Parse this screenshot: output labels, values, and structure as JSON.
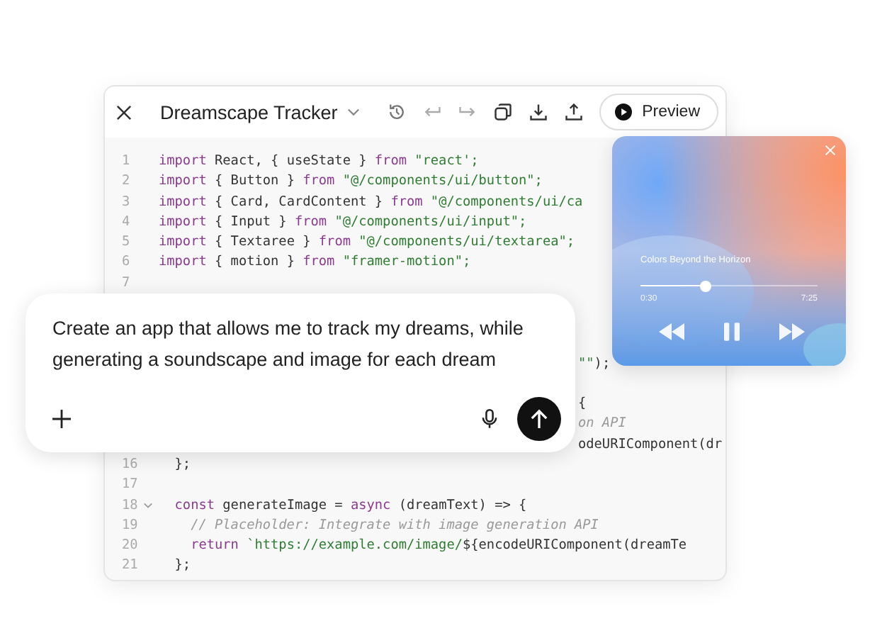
{
  "editor": {
    "title": "Dreamscape Tracker",
    "preview_button": "Preview",
    "lines": [
      {
        "kind": "line",
        "number": "1",
        "segments": [
          {
            "kind": "keyword",
            "text": "import"
          },
          {
            "kind": "plain",
            "text": " React, { useState } "
          },
          {
            "kind": "keyword",
            "text": "from"
          },
          {
            "kind": "string",
            "text": " \"react';"
          }
        ]
      },
      {
        "kind": "line",
        "number": "2",
        "segments": [
          {
            "kind": "keyword",
            "text": "import"
          },
          {
            "kind": "plain",
            "text": " { Button } "
          },
          {
            "kind": "keyword",
            "text": "from"
          },
          {
            "kind": "string",
            "text": " \"@/components/ui/button\";"
          }
        ]
      },
      {
        "kind": "line",
        "number": "3",
        "segments": [
          {
            "kind": "keyword",
            "text": "import"
          },
          {
            "kind": "plain",
            "text": " { Card, CardContent } "
          },
          {
            "kind": "keyword",
            "text": "from"
          },
          {
            "kind": "string",
            "text": " \"@/components/ui/ca"
          }
        ]
      },
      {
        "kind": "line",
        "number": "4",
        "segments": [
          {
            "kind": "keyword",
            "text": "import"
          },
          {
            "kind": "plain",
            "text": " { Input } "
          },
          {
            "kind": "keyword",
            "text": "from"
          },
          {
            "kind": "string",
            "text": " \"@/components/ui/input\";"
          }
        ]
      },
      {
        "kind": "line",
        "number": "5",
        "segments": [
          {
            "kind": "keyword",
            "text": "import"
          },
          {
            "kind": "plain",
            "text": " { Textaree } "
          },
          {
            "kind": "keyword",
            "text": "from"
          },
          {
            "kind": "string",
            "text": " \"@/components/ui/textarea\";"
          }
        ]
      },
      {
        "kind": "line",
        "number": "6",
        "segments": [
          {
            "kind": "keyword",
            "text": "import"
          },
          {
            "kind": "plain",
            "text": " { motion } "
          },
          {
            "kind": "keyword",
            "text": "from"
          },
          {
            "kind": "string",
            "text": " \"framer-motion\";"
          }
        ]
      },
      {
        "kind": "line",
        "number": "7"
      },
      {
        "kind": "covered"
      },
      {
        "kind": "covered"
      },
      {
        "kind": "covered"
      },
      {
        "kind": "covered",
        "segments": [
          {
            "kind": "string",
            "text": "\"\""
          },
          {
            "kind": "plain",
            "text": ");"
          }
        ]
      },
      {
        "kind": "covered"
      },
      {
        "kind": "covered",
        "segments": [
          {
            "kind": "plain",
            "text": "{"
          }
        ]
      },
      {
        "kind": "covered",
        "segments": [
          {
            "kind": "comment",
            "text": "on API"
          }
        ]
      },
      {
        "kind": "covered",
        "segments": [
          {
            "kind": "plain",
            "text": "odeURIComponent(dr"
          }
        ]
      },
      {
        "kind": "line",
        "number": "16",
        "segments": [
          {
            "kind": "plain",
            "text": "  };"
          }
        ]
      },
      {
        "kind": "line",
        "number": "17"
      },
      {
        "kind": "line",
        "number": "18",
        "expanded": true,
        "segments": [
          {
            "kind": "keyword",
            "text": "  const"
          },
          {
            "kind": "plain",
            "text": " generateImage = "
          },
          {
            "kind": "keyword",
            "text": "async"
          },
          {
            "kind": "plain",
            "text": " (dreamText) => {"
          }
        ]
      },
      {
        "kind": "line",
        "number": "19",
        "segments": [
          {
            "kind": "comment",
            "text": "    // Placeholder: Integrate with image generation API"
          }
        ]
      },
      {
        "kind": "line",
        "number": "20",
        "segments": [
          {
            "kind": "keyword",
            "text": "    return"
          },
          {
            "kind": "string",
            "text": " `https://example.com/image/"
          },
          {
            "kind": "plain",
            "text": "${encodeURIComponent(dreamTe"
          }
        ]
      },
      {
        "kind": "line",
        "number": "21",
        "segments": [
          {
            "kind": "plain",
            "text": "  };"
          }
        ]
      }
    ]
  },
  "player": {
    "title": "Colors Beyond the Horizon",
    "level": 0.37,
    "elapsed": "0:30",
    "duration": "7:25"
  },
  "prompt": {
    "text": "Create an app that allows me to track my dreams, while generating a soundscape and image for each dream"
  }
}
